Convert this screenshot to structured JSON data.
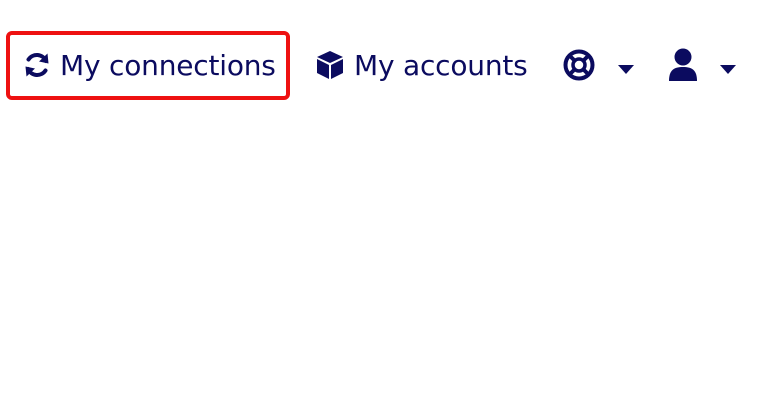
{
  "nav": {
    "connections_label": "My connections",
    "accounts_label": "My accounts",
    "help_menu_icon": "lifebuoy-icon",
    "user_menu_icon": "user-icon"
  },
  "colors": {
    "nav_text": "#0b0b5f",
    "highlight": "#ee1111",
    "background": "#ffffff"
  }
}
